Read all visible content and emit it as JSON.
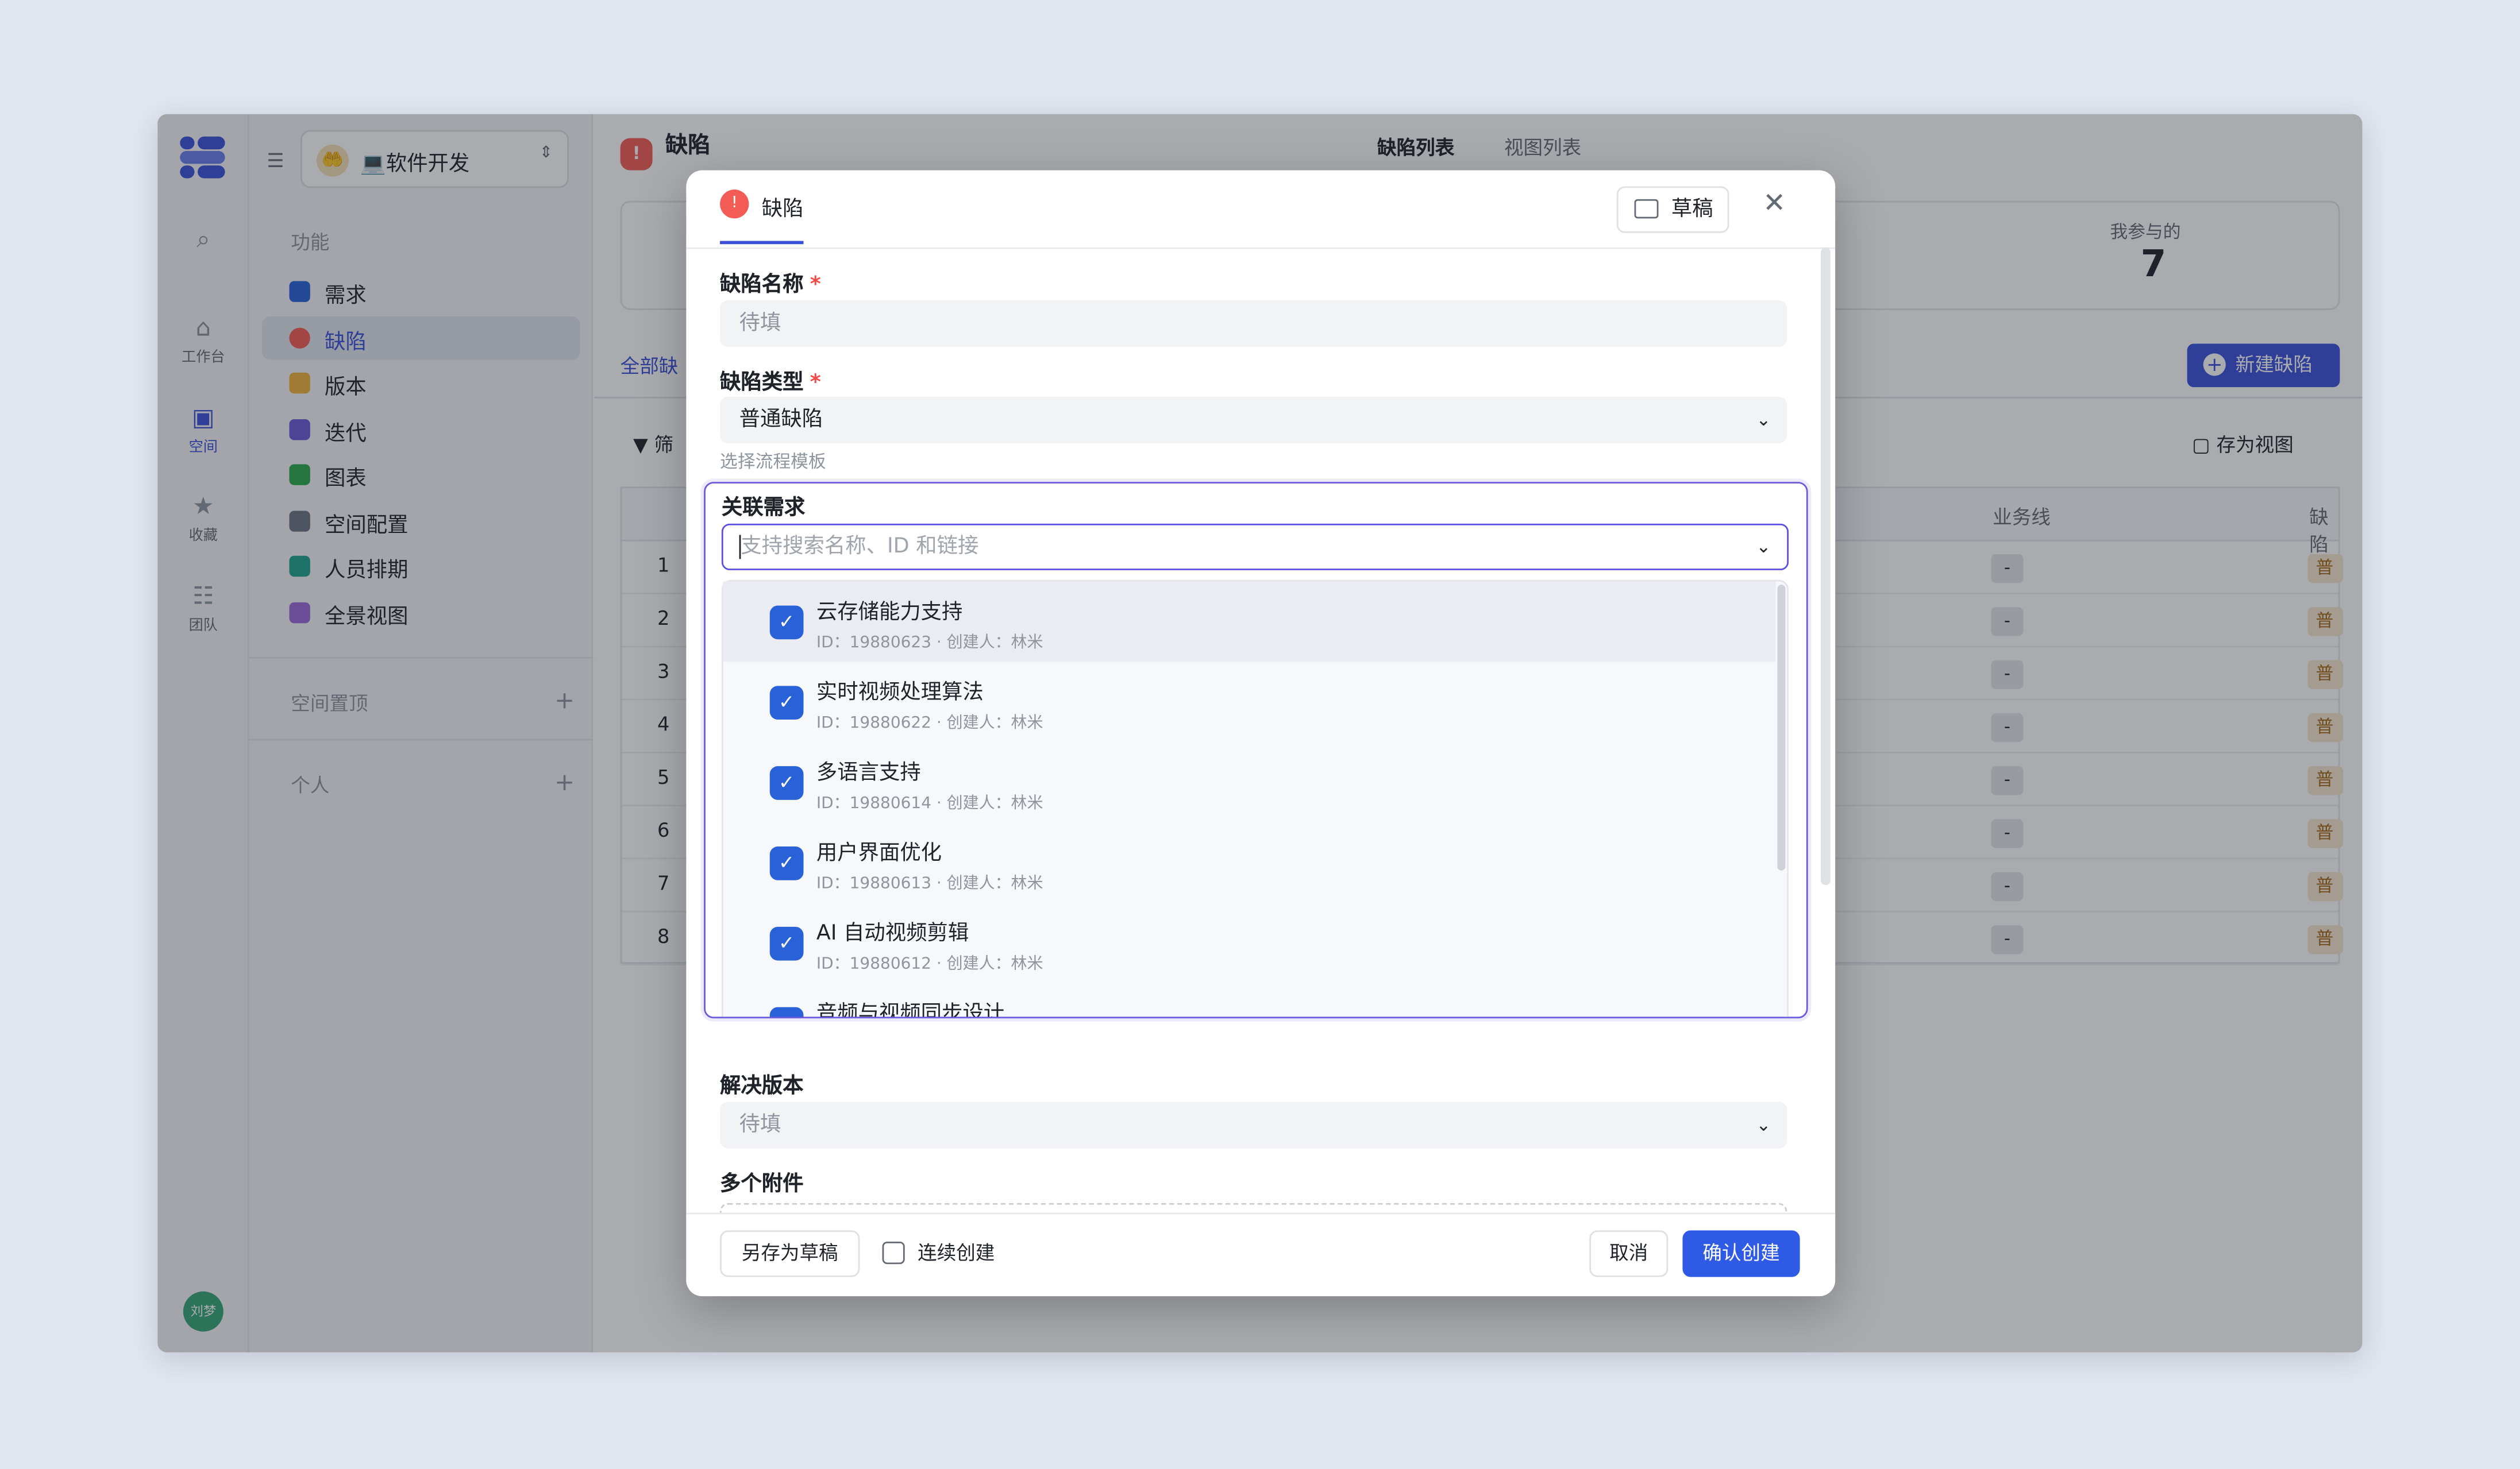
{
  "rail": {
    "items": [
      {
        "label": "",
        "icon": "search-icon"
      },
      {
        "label": "工作台",
        "icon": "home-icon"
      },
      {
        "label": "空间",
        "icon": "space-icon"
      },
      {
        "label": "收藏",
        "icon": "star-icon"
      },
      {
        "label": "团队",
        "icon": "team-icon"
      }
    ],
    "avatar": "刘梦"
  },
  "sidebar": {
    "space_emoji": "💻",
    "space_name": "软件开发",
    "section_title": "功能",
    "items": [
      {
        "label": "需求",
        "color": "#2961d8"
      },
      {
        "label": "缺陷",
        "color": "#f25c54"
      },
      {
        "label": "版本",
        "color": "#f0b23a"
      },
      {
        "label": "迭代",
        "color": "#6b5ad8"
      },
      {
        "label": "图表",
        "color": "#2aa84a"
      },
      {
        "label": "空间配置",
        "color": "#6d7380"
      },
      {
        "label": "人员排期",
        "color": "#1ea38b"
      },
      {
        "label": "全景视图",
        "color": "#9b6ad8"
      }
    ],
    "pinned_title": "空间置顶",
    "personal_title": "个人"
  },
  "main": {
    "title": "缺陷",
    "tabs": [
      "缺陷列表",
      "视图列表"
    ],
    "stat_label": "我参与的",
    "stat_value": "7",
    "all_tab": "全部缺",
    "new_button": "新建缺陷",
    "filter_label": "筛",
    "save_view": "存为视图",
    "columns": [
      "业务线",
      "缺陷"
    ],
    "rows": [
      "1",
      "2",
      "3",
      "4",
      "5",
      "6",
      "7",
      "8"
    ],
    "cell_dash": "-",
    "cell_type": "普"
  },
  "modal": {
    "tab_title": "缺陷",
    "draft_button": "草稿",
    "name_label": "缺陷名称",
    "name_placeholder": "待填",
    "type_label": "缺陷类型",
    "type_value": "普通缺陷",
    "type_hint": "选择流程模板",
    "assoc_label": "关联需求",
    "assoc_placeholder": "支持搜索名称、ID 和链接",
    "options": [
      {
        "title": "云存储能力支持",
        "meta": "ID：19880623 · 创建人：林米"
      },
      {
        "title": "实时视频处理算法",
        "meta": "ID：19880622 · 创建人：林米"
      },
      {
        "title": "多语言支持",
        "meta": "ID：19880614 · 创建人：林米"
      },
      {
        "title": "用户界面优化",
        "meta": "ID：19880613 · 创建人：林米"
      },
      {
        "title": "AI 自动视频剪辑",
        "meta": "ID：19880612 · 创建人：林米"
      },
      {
        "title": "音频与视频同步设计",
        "meta": ""
      }
    ],
    "version_label": "解决版本",
    "version_placeholder": "待填",
    "attach_label": "多个附件",
    "save_draft": "另存为草稿",
    "continue_create": "连续创建",
    "cancel": "取消",
    "confirm": "确认创建"
  }
}
